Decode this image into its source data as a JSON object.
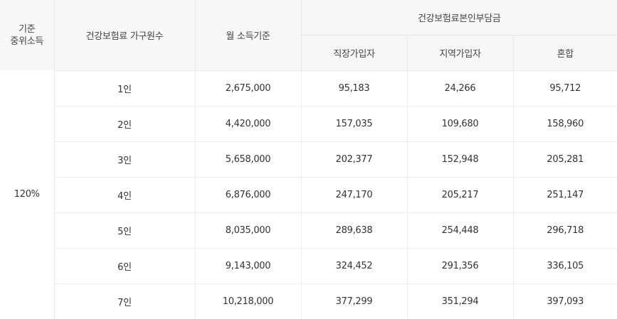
{
  "header": {
    "median_income_line1": "기준",
    "median_income_line2": "중위소득",
    "household_members": "건강보험료 가구원수",
    "monthly_income": "월 소득기준",
    "premium_group": "건강보험료본인부담금",
    "employee": "직장가입자",
    "regional": "지역가입자",
    "mixed": "혼합"
  },
  "ratio": "120%",
  "rows": [
    {
      "members": "1인",
      "income": "2,675,000",
      "employee": "95,183",
      "regional": "24,266",
      "mixed": "95,712"
    },
    {
      "members": "2인",
      "income": "4,420,000",
      "employee": "157,035",
      "regional": "109,680",
      "mixed": "158,960"
    },
    {
      "members": "3인",
      "income": "5,658,000",
      "employee": "202,377",
      "regional": "152,948",
      "mixed": "205,281"
    },
    {
      "members": "4인",
      "income": "6,876,000",
      "employee": "247,170",
      "regional": "205,217",
      "mixed": "251,147"
    },
    {
      "members": "5인",
      "income": "8,035,000",
      "employee": "289,638",
      "regional": "254,448",
      "mixed": "296,718"
    },
    {
      "members": "6인",
      "income": "9,143,000",
      "employee": "324,452",
      "regional": "291,356",
      "mixed": "336,105"
    },
    {
      "members": "7인",
      "income": "10,218,000",
      "employee": "377,299",
      "regional": "351,294",
      "mixed": "397,093"
    }
  ]
}
